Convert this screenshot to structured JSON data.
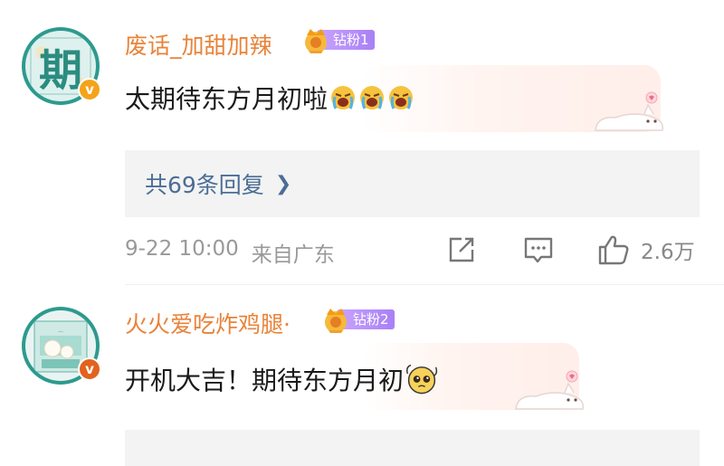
{
  "comments": [
    {
      "avatar_glyph": "期",
      "username": "废话_加甜加辣",
      "fan_badge": "钻粉1",
      "text": "太期待东方月初啦",
      "emojis": [
        "crying-emoji",
        "crying-emoji",
        "crying-emoji"
      ],
      "replies_label": "共69条回复",
      "timestamp": "9-22 10:00",
      "location": "来自广东",
      "likes": "2.6万"
    },
    {
      "username": "火火爱吃炸鸡腿·",
      "fan_badge": "钻粉2",
      "text": "开机大吉！期待东方月初",
      "emojis": [
        "pleading-emoji"
      ]
    }
  ],
  "colors": {
    "username": "#e8833a",
    "link": "#4b6e96",
    "meta": "#999999",
    "avatar": "#2d9a8e",
    "verified": "#f4a31b",
    "badge": "#a880f5"
  }
}
